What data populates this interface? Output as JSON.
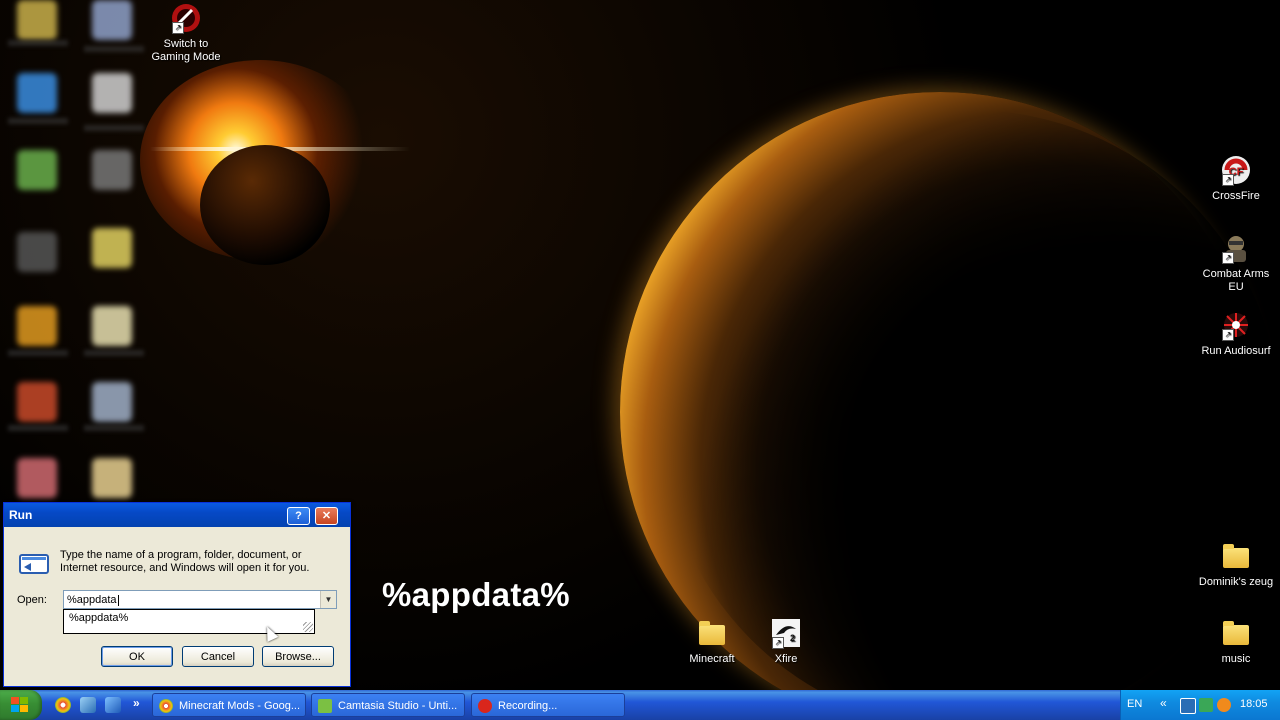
{
  "desktop": {
    "icons_left": [
      {
        "label": "Switch to Gaming Mode"
      }
    ],
    "icons_right": [
      {
        "label": "CrossFire"
      },
      {
        "label": "Combat Arms EU"
      },
      {
        "label": "Run Audiosurf"
      },
      {
        "label": "Dominik's zeug"
      },
      {
        "label": "music"
      }
    ],
    "icons_bottom": [
      {
        "label": "Minecraft"
      },
      {
        "label": "Xfire"
      }
    ],
    "overlay_text": "%appdata%"
  },
  "run_dialog": {
    "title": "Run",
    "help_label": "?",
    "close_label": "✕",
    "description": "Type the name of a program, folder, document, or Internet resource, and Windows will open it for you.",
    "open_label": "Open:",
    "open_value": "%appdata",
    "autocomplete_item": "%appdata%",
    "ok_label": "OK",
    "cancel_label": "Cancel",
    "browse_label": "Browse..."
  },
  "taskbar": {
    "quicklaunch_more": "»",
    "tasks": [
      {
        "label": "Minecraft Mods - Goog...",
        "icon_color": "#e4a11b"
      },
      {
        "label": "Camtasia Studio - Unti...",
        "icon_color": "#7bc043"
      },
      {
        "label": "Recording...",
        "icon_color": "#d9261c"
      }
    ],
    "tray": {
      "language": "EN",
      "chevron": "«",
      "clock": "18:05"
    }
  },
  "colors": {
    "title_bar": "#0a5ae0",
    "taskbar": "#2157d7",
    "start": "#388e34",
    "tray": "#0f8be0"
  }
}
